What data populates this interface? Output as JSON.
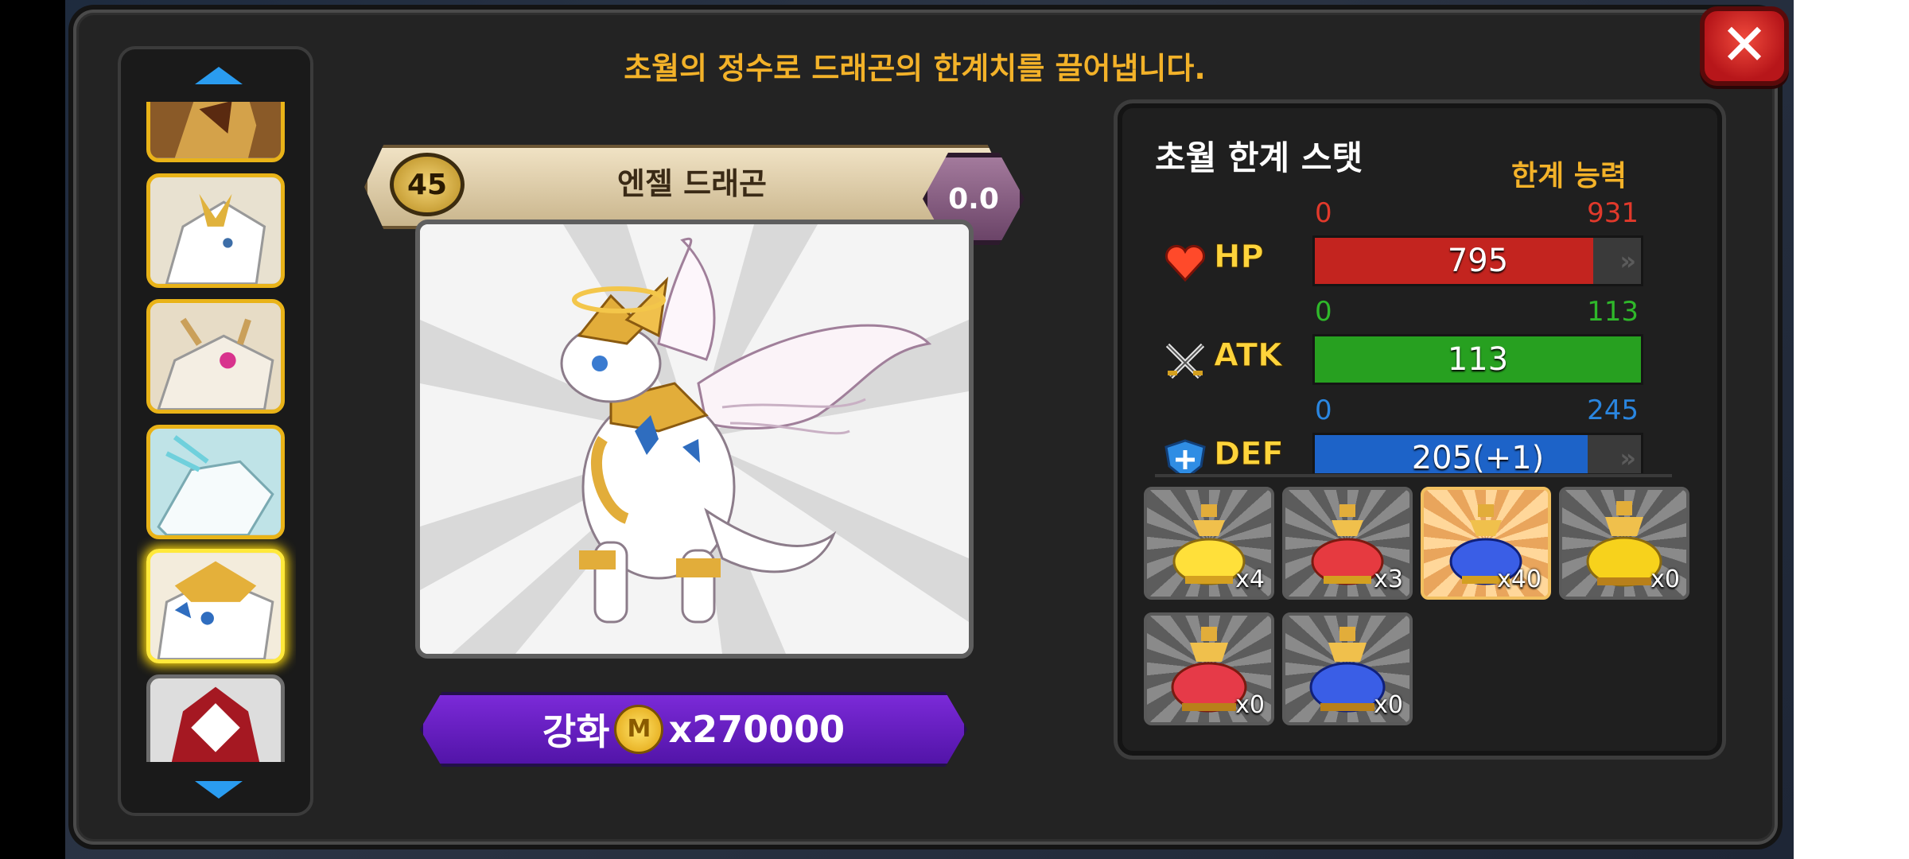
{
  "headline": "초월의 정수로 드래곤의 한계치를 끌어냅니다.",
  "dragon": {
    "level": "45",
    "name": "엔젤 드래곤",
    "grade": "0.0"
  },
  "enhance": {
    "label": "강화",
    "coin_symbol": "M",
    "cost": "x270000"
  },
  "stats": {
    "title": "초월 한계 스탯",
    "limit_label": "한계 능력",
    "rows": [
      {
        "key": "hp",
        "label": "HP",
        "min": "0",
        "max": "931",
        "value": "795",
        "value_num": 795,
        "max_num": 931,
        "color": "#c3241f",
        "label_color": "#e2392b"
      },
      {
        "key": "atk",
        "label": "ATK",
        "min": "0",
        "max": "113",
        "value": "113",
        "value_num": 113,
        "max_num": 113,
        "color": "#27a020",
        "label_color": "#2fb82a"
      },
      {
        "key": "def",
        "label": "DEF",
        "min": "0",
        "max": "245",
        "value": "205(+1)",
        "value_num": 205,
        "max_num": 245,
        "color": "#1d63c8",
        "label_color": "#2a86e0"
      }
    ]
  },
  "items": [
    {
      "color": "yellow",
      "count": "x4"
    },
    {
      "color": "red",
      "count": "x3"
    },
    {
      "color": "blue",
      "count": "x40",
      "selected": true
    },
    {
      "color": "gold",
      "count": "x0"
    },
    {
      "color": "red-large",
      "count": "x0"
    },
    {
      "color": "blue-large",
      "count": "x0"
    }
  ],
  "colors": {
    "accent_gold": "#f3b229",
    "close_red": "#d42020",
    "enhance_purple": "#6a1fc8"
  }
}
